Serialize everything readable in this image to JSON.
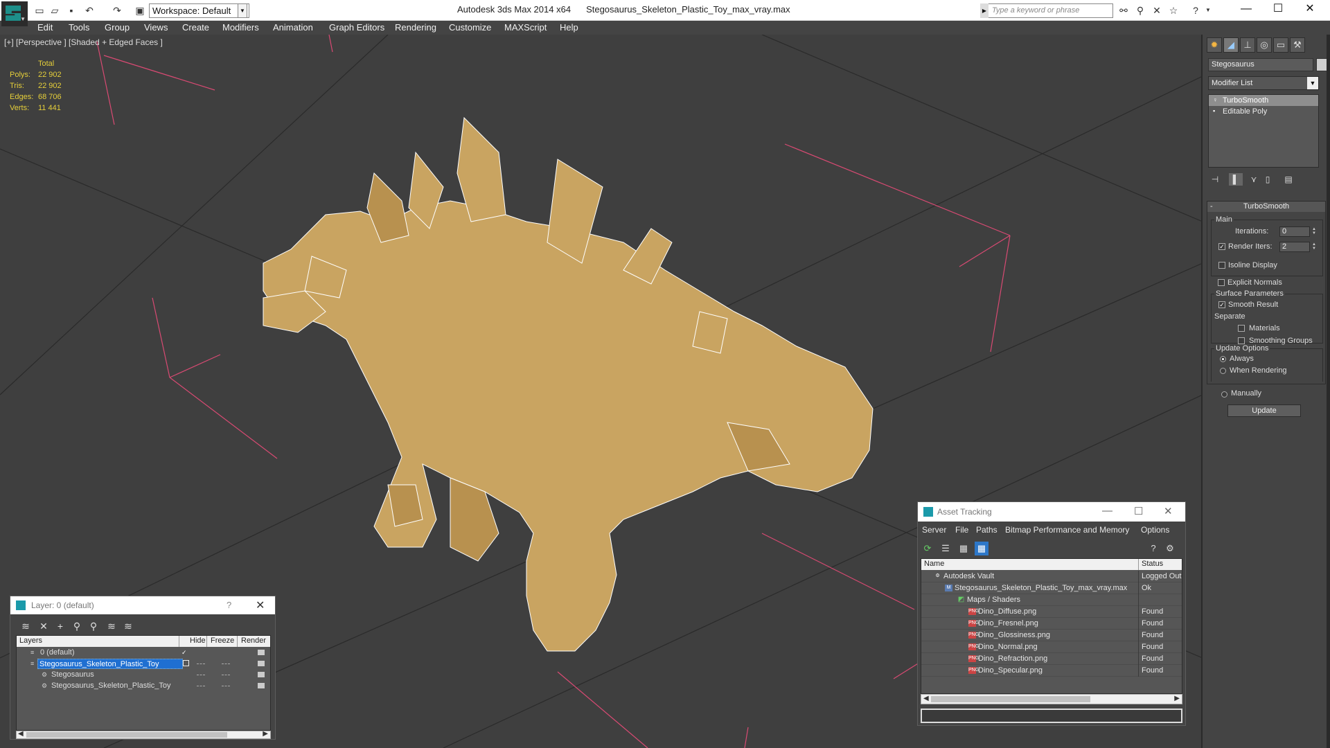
{
  "titlebar": {
    "app_name": "Autodesk 3ds Max  2014 x64",
    "file_name": "Stegosaurus_Skeleton_Plastic_Toy_max_vray.max",
    "workspace": "Workspace: Default",
    "search_placeholder": "Type a keyword or phrase",
    "minimize": "—",
    "maximize": "☐",
    "close": "✕"
  },
  "menu": [
    "Edit",
    "Tools",
    "Group",
    "Views",
    "Create",
    "Modifiers",
    "Animation",
    "Graph Editors",
    "Rendering",
    "Customize",
    "MAXScript",
    "Help"
  ],
  "viewport": {
    "label": "[+] [Perspective ] [Shaded + Edged Faces ]",
    "stats": {
      "header": "Total",
      "rows": [
        {
          "key": "Polys:",
          "value": "22 902"
        },
        {
          "key": "Tris:",
          "value": "22 902"
        },
        {
          "key": "Edges:",
          "value": "68 706"
        },
        {
          "key": "Verts:",
          "value": "11 441"
        }
      ]
    },
    "model_fill": "#c9a461",
    "wire_color": "#ffffff",
    "grid_accent": "#d94a73"
  },
  "command_panel": {
    "object_name": "Stegosaurus",
    "modifier_list": "Modifier List",
    "stack": [
      "TurboSmooth",
      "Editable Poly"
    ],
    "turbosmooth": {
      "title": "TurboSmooth",
      "main_label": "Main",
      "iterations_label": "Iterations:",
      "iterations": "0",
      "render_iters_label": "Render Iters:",
      "render_iters": "2",
      "isoline_display": "Isoline Display",
      "explicit_normals": "Explicit Normals",
      "surface_params": "Surface Parameters",
      "smooth_result": "Smooth Result",
      "separate": "Separate",
      "materials": "Materials",
      "smoothing_groups": "Smoothing Groups",
      "update_options": "Update Options",
      "always": "Always",
      "when_rendering": "When Rendering",
      "manually": "Manually",
      "update_button": "Update"
    }
  },
  "layer_dialog": {
    "title": "Layer: 0 (default)",
    "help": "?",
    "close": "✕",
    "columns": [
      "Layers",
      "Hide",
      "Freeze",
      "Render"
    ],
    "rows": [
      {
        "name": "0 (default)",
        "indent": 1
      },
      {
        "name": "Stegosaurus_Skeleton_Plastic_Toy",
        "indent": 1
      },
      {
        "name": "Stegosaurus",
        "indent": 2
      },
      {
        "name": "Stegosaurus_Skeleton_Plastic_Toy",
        "indent": 2
      }
    ]
  },
  "asset_tracking": {
    "title": "Asset Tracking",
    "menu": [
      "Server",
      "File",
      "Paths",
      "Bitmap Performance and Memory",
      "Options"
    ],
    "columns": [
      "Name",
      "Status"
    ],
    "rows": [
      {
        "name": "Autodesk Vault",
        "status": "Logged Out"
      },
      {
        "name": "Stegosaurus_Skeleton_Plastic_Toy_max_vray.max",
        "status": "Ok"
      },
      {
        "name": "Maps / Shaders",
        "status": ""
      },
      {
        "name": "Dino_Diffuse.png",
        "status": "Found"
      },
      {
        "name": "Dino_Fresnel.png",
        "status": "Found"
      },
      {
        "name": "Dino_Glossiness.png",
        "status": "Found"
      },
      {
        "name": "Dino_Normal.png",
        "status": "Found"
      },
      {
        "name": "Dino_Refraction.png",
        "status": "Found"
      },
      {
        "name": "Dino_Specular.png",
        "status": "Found"
      }
    ]
  }
}
